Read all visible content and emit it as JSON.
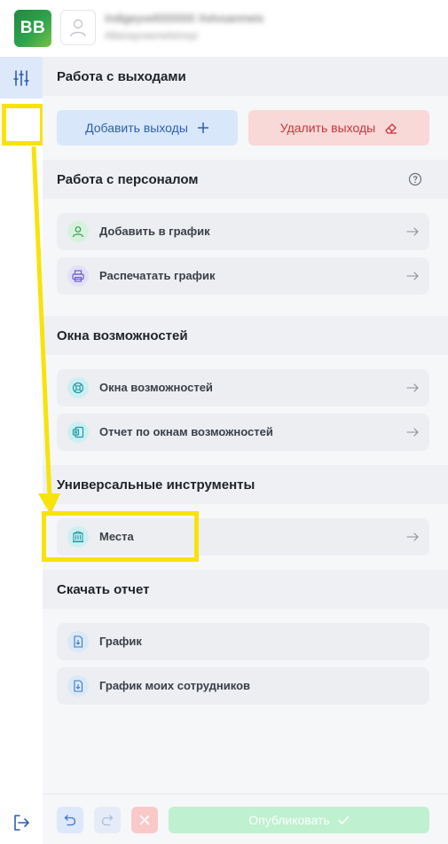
{
  "header": {
    "logo_text": "BB",
    "user_name": "Indigeyvel000000 Xelvsanmeis",
    "user_role": "Allanayvavnelsinoyi"
  },
  "panel": {
    "exits": {
      "title": "Работа с выходами",
      "add_label": "Добавить выходы",
      "delete_label": "Удалить выходы"
    },
    "staff": {
      "title": "Работа с персоналом",
      "items": [
        {
          "label": "Добавить в график",
          "icon": "user-icon"
        },
        {
          "label": "Распечатать график",
          "icon": "printer-icon"
        }
      ]
    },
    "windows": {
      "title": "Окна возможностей",
      "items": [
        {
          "label": "Окна возможностей",
          "icon": "lifebuoy-icon"
        },
        {
          "label": "Отчет по окнам возможностей",
          "icon": "excel-icon"
        }
      ]
    },
    "tools": {
      "title": "Универсальные инструменты",
      "items": [
        {
          "label": "Места",
          "icon": "building-icon"
        }
      ]
    },
    "download": {
      "title": "Скачать отчет",
      "items": [
        {
          "label": "График",
          "icon": "file-download-icon"
        },
        {
          "label": "График моих сотрудников",
          "icon": "file-download-icon"
        }
      ]
    }
  },
  "toolbar": {
    "publish_label": "Опубликовать"
  },
  "colors": {
    "annotation": "#f7e30a",
    "primary": "#2c5fb0",
    "danger": "#c8373a",
    "publish_disabled": "#bff0cf"
  }
}
